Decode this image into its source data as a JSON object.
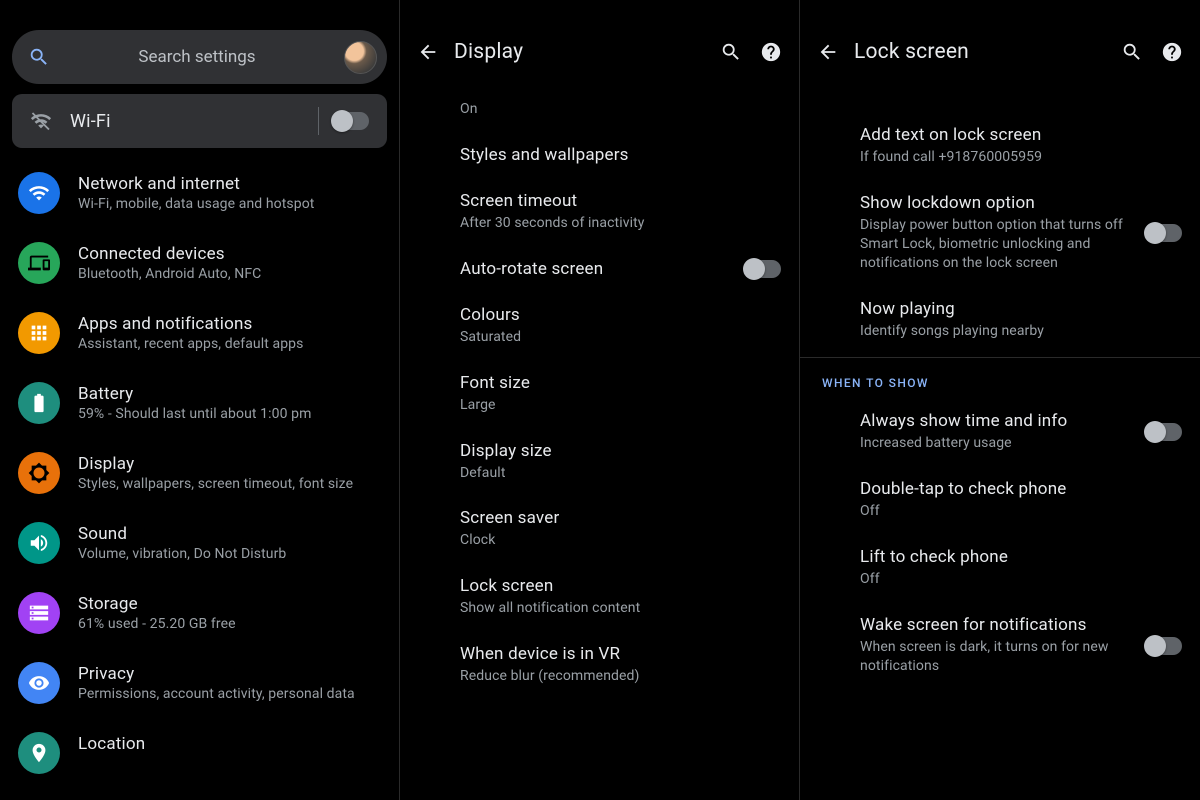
{
  "pane1": {
    "search_placeholder": "Search settings",
    "wifi": {
      "label": "Wi-Fi",
      "toggled": false
    },
    "items": [
      {
        "title": "Network and internet",
        "sub": "Wi-Fi, mobile, data usage and hotspot",
        "icon": "wifi",
        "color": "c-blue"
      },
      {
        "title": "Connected devices",
        "sub": "Bluetooth, Android Auto, NFC",
        "icon": "devices",
        "color": "c-green"
      },
      {
        "title": "Apps and notifications",
        "sub": "Assistant, recent apps, default apps",
        "icon": "apps",
        "color": "c-orange"
      },
      {
        "title": "Battery",
        "sub": "59% - Should last until about 1:00 pm",
        "icon": "battery",
        "color": "c-teal1"
      },
      {
        "title": "Display",
        "sub": "Styles, wallpapers, screen timeout, font size",
        "icon": "brightness",
        "color": "c-darkorange"
      },
      {
        "title": "Sound",
        "sub": "Volume, vibration, Do Not Disturb",
        "icon": "sound",
        "color": "c-teal2"
      },
      {
        "title": "Storage",
        "sub": "61% used - 25.20 GB free",
        "icon": "storage",
        "color": "c-purple"
      },
      {
        "title": "Privacy",
        "sub": "Permissions, account activity, personal data",
        "icon": "privacy",
        "color": "c-blue2"
      },
      {
        "title": "Location",
        "sub": "",
        "icon": "location",
        "color": "c-teal1"
      }
    ]
  },
  "pane2": {
    "title": "Display",
    "items": [
      {
        "title": "",
        "sub": "On"
      },
      {
        "title": "Styles and wallpapers",
        "sub": ""
      },
      {
        "title": "Screen timeout",
        "sub": "After 30 seconds of inactivity"
      },
      {
        "title": "Auto-rotate screen",
        "sub": "",
        "toggle": true,
        "toggled": false
      },
      {
        "title": "Colours",
        "sub": "Saturated"
      },
      {
        "title": "Font size",
        "sub": "Large"
      },
      {
        "title": "Display size",
        "sub": "Default"
      },
      {
        "title": "Screen saver",
        "sub": "Clock"
      },
      {
        "title": "Lock screen",
        "sub": "Show all notification content"
      },
      {
        "title": "When device is in VR",
        "sub": "Reduce blur (recommended)"
      }
    ]
  },
  "pane3": {
    "title": "Lock screen",
    "itemsA": [
      {
        "title": "Add text on lock screen",
        "sub": "If found call +918760005959"
      },
      {
        "title": "Show lockdown option",
        "sub": "Display power button option that turns off Smart Lock, biometric unlocking and notifications on the lock screen",
        "toggle": true,
        "toggled": false
      },
      {
        "title": "Now playing",
        "sub": "Identify songs playing nearby"
      }
    ],
    "section_label": "WHEN TO SHOW",
    "itemsB": [
      {
        "title": "Always show time and info",
        "sub": "Increased battery usage",
        "toggle": true,
        "toggled": false
      },
      {
        "title": "Double-tap to check phone",
        "sub": "Off"
      },
      {
        "title": "Lift to check phone",
        "sub": "Off"
      },
      {
        "title": "Wake screen for notifications",
        "sub": "When screen is dark, it turns on for new notifications",
        "toggle": true,
        "toggled": false
      }
    ]
  },
  "icons": {
    "search": "search",
    "help": "help",
    "back": "back"
  }
}
